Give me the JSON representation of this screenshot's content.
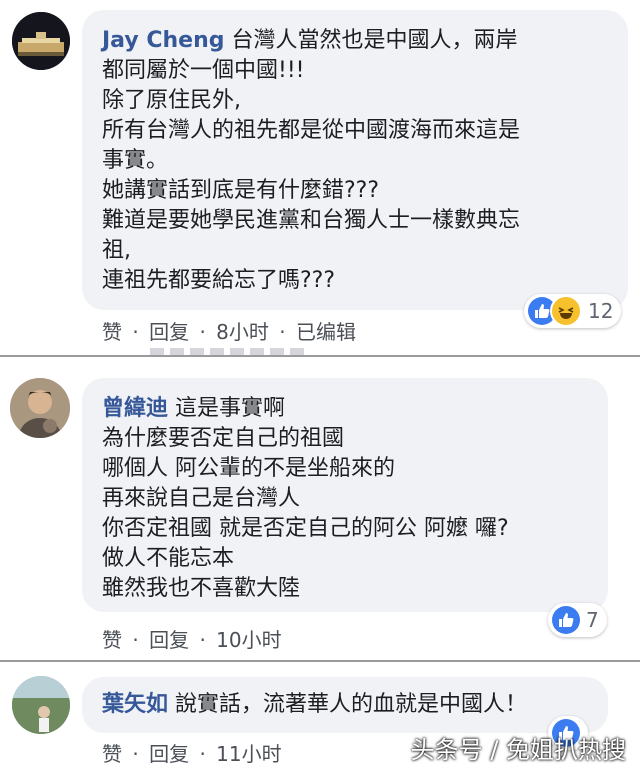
{
  "comments": [
    {
      "author": "Jay Cheng",
      "first_line": "台灣人當然也是中國人，兩岸",
      "lines": [
        "都同屬於一個中國!!!",
        "除了原住民外,",
        "所有台灣人的祖先都是從中國渡海而來這是",
        "事實。",
        "她講實話到底是有什麼錯???",
        "難道是要她學民進黨和台獨人士一樣數典忘",
        "祖,",
        "連祖先都要給忘了嗎???"
      ],
      "like": "赞",
      "reply": "回复",
      "time": "8小时",
      "edited": "已编辑",
      "reaction_count": "12"
    },
    {
      "author": "曾緯迪",
      "first_line": "這是事實啊",
      "lines": [
        "為什麼要否定自己的祖國",
        "哪個人 阿公輩的不是坐船來的",
        "再來說自己是台灣人",
        "你否定祖國 就是否定自己的阿公 阿嬤 囉?",
        "做人不能忘本",
        "雖然我也不喜歡大陸"
      ],
      "like": "赞",
      "reply": "回复",
      "time": "10小时",
      "reaction_count": "7"
    },
    {
      "author": "葉矢如",
      "first_line": "說實話，流著華人的血就是中國人！",
      "like": "赞",
      "reply": "回复",
      "time": "11小时"
    }
  ],
  "separator": "·",
  "watermark": "头条号 / 免姐扒热搜",
  "colors": {
    "author": "#365899",
    "bubble": "#f1f2f6",
    "like": "#3b7cf1",
    "haha": "#f7c12d"
  }
}
